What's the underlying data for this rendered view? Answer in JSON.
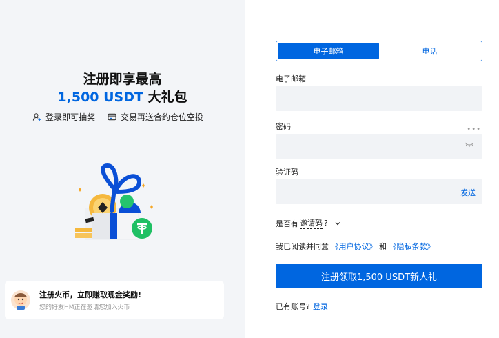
{
  "promo": {
    "headline_line1": "注册即享最高",
    "headline_amount": "1,500 USDT",
    "headline_suffix": " 大礼包",
    "features": [
      {
        "icon": "user-plus-icon",
        "label": "登录即可抽奖"
      },
      {
        "icon": "card-icon",
        "label": "交易再送合约仓位空投"
      }
    ],
    "invite_title": "注册火币，立即赚取现金奖励!",
    "invite_sub": "您的好友HM正在邀请您加入火币"
  },
  "form": {
    "tabs": [
      {
        "label": "电子邮箱",
        "active": true
      },
      {
        "label": "电话",
        "active": false
      }
    ],
    "email_label": "电子邮箱",
    "email_value": "",
    "password_label": "密码",
    "password_value": "",
    "code_label": "验证码",
    "code_value": "",
    "send_label": "发送",
    "promo_prefix": "是否有",
    "promo_link": "邀请码",
    "promo_suffix": "?",
    "agree_text": "我已阅读并同意",
    "user_agreement": "《用户协议》",
    "and_text": "和",
    "privacy_policy": "《隐私条款》",
    "submit_label": "注册领取1,500 USDT新人礼",
    "have_account": "已有账号?",
    "login_link": "登录"
  },
  "colors": {
    "accent": "#0066e0",
    "panel_bg": "#f3f5f8",
    "field_bg": "#f1f3f6"
  }
}
